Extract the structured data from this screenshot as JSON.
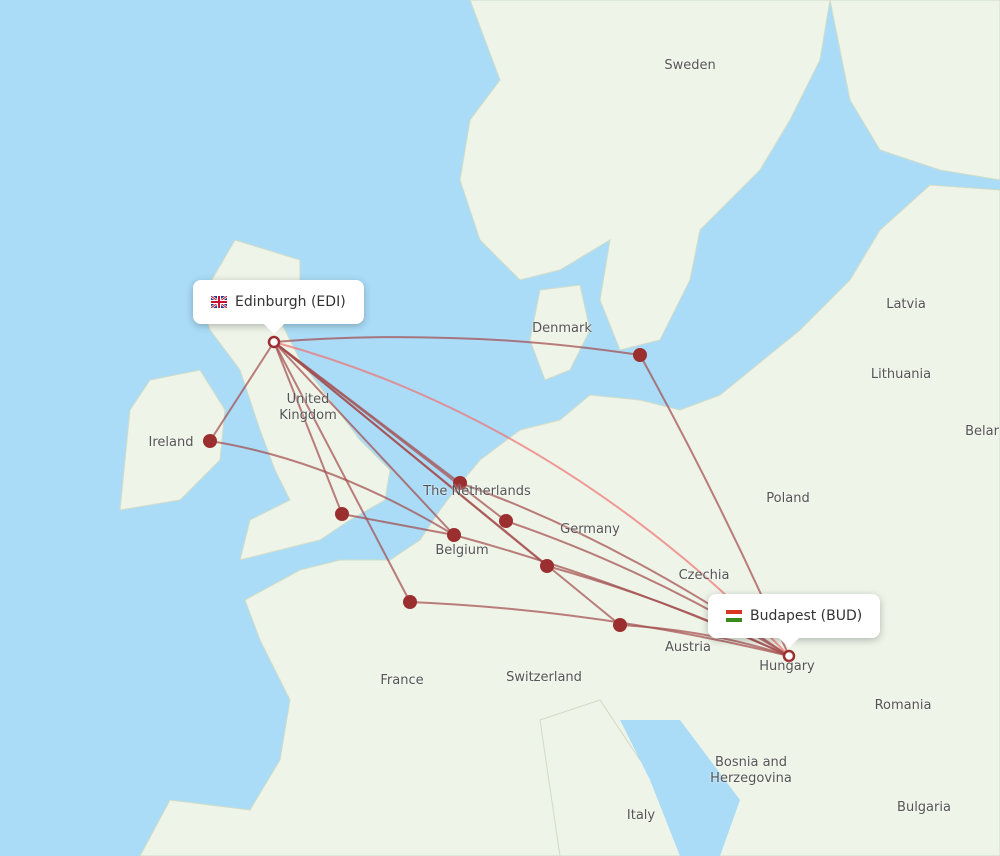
{
  "map": {
    "colors": {
      "sea": "#aadcf7",
      "land": "#eef4e8",
      "route": "#a3484a",
      "route_direct": "#f07070",
      "dot": "#9b2f30"
    },
    "country_labels": [
      "Sweden",
      "Denmark",
      "Latvia",
      "Lithuania",
      "Belar",
      "United Kingdom",
      "Ireland",
      "The Netherlands",
      "Germany",
      "Poland",
      "Belgium",
      "Czechia",
      "Austria",
      "Hungary",
      "Switzerland",
      "France",
      "Romania",
      "Bosnia and Herzegovina",
      "Bulgaria",
      "Italy"
    ]
  },
  "origin": {
    "label": "Edinburgh (EDI)",
    "flag_icon": "uk-flag"
  },
  "destination": {
    "label": "Budapest (BUD)",
    "flag_icon": "hungary-flag"
  }
}
